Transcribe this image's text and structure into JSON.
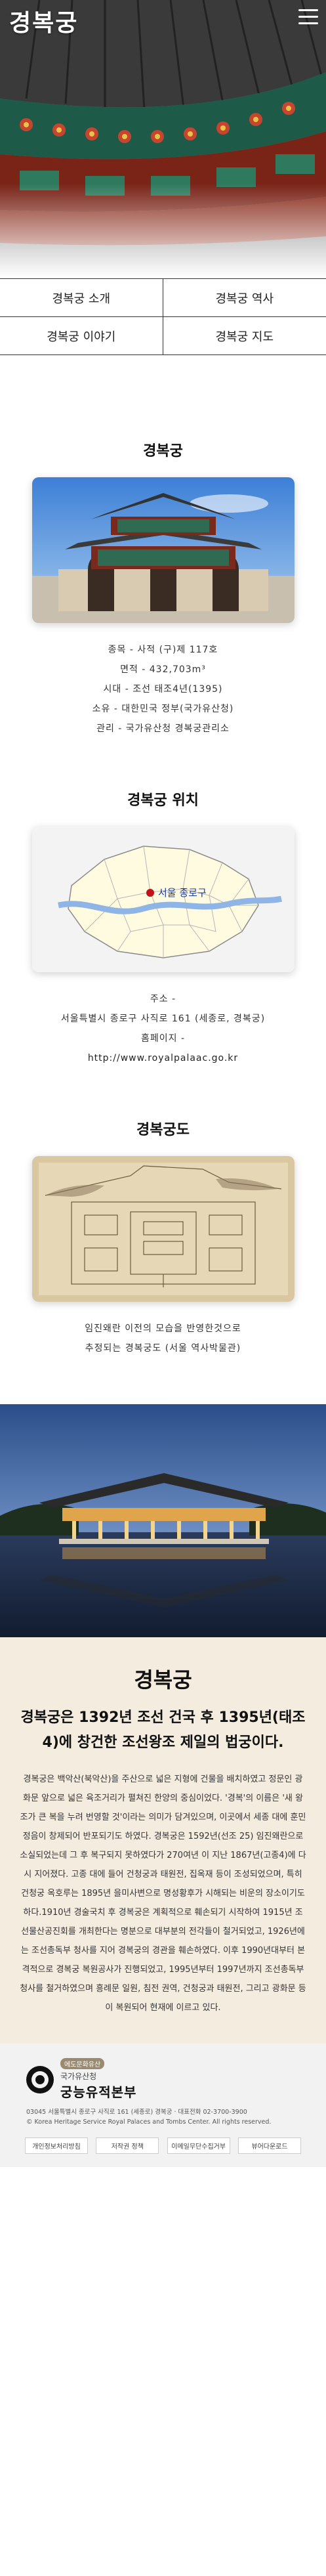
{
  "header": {
    "brand": "경복궁",
    "menu_icon": "hamburger-menu-icon"
  },
  "nav": {
    "items": [
      {
        "label": "경복궁 소개"
      },
      {
        "label": "경복궁 역사"
      },
      {
        "label": "경복궁 이야기"
      },
      {
        "label": "경복궁 지도"
      }
    ]
  },
  "intro": {
    "title": "경복궁",
    "lines": [
      "종목 - 사적 (구)제 117호",
      "면적 - 432,703m³",
      "시대 - 조선 태조4년(1395)",
      "소유 - 대한민국 정부(국가유산청)",
      "관리 - 국가유산청 경복궁관리소"
    ]
  },
  "location": {
    "title": "경복궁 위치",
    "map_label": "서울 종로구",
    "lines": [
      "주소 -",
      "서울특별시 종로구 사직로 161 (세종로, 경복궁)",
      "홈페이지 -",
      "http://www.royalpalaac.go.kr"
    ]
  },
  "palace_map": {
    "title": "경복궁도",
    "lines": [
      "임진왜란 이전의 모습을 반영한것으로",
      "추정되는 경복궁도 (서울 역사박물관)"
    ]
  },
  "about": {
    "title": "경복궁",
    "lead": "경복궁은 1392년 조선 건국 후 1395년(태조 4)에 창건한 조선왕조 제일의 법궁이다.",
    "body": "경복궁은 백악산(북악산)을 주산으로 넓은 지형에 건물을 배치하였고 정문인 광화문 앞으로 넓은 육조거리가 펼쳐진 한양의 중심이었다. '경복'의 이름은 '새 왕조가 큰 복을 누려 번영할 것'이라는 의미가 담겨있으며, 이곳에서 세종 대에 훈민정음이 창제되어 반포되기도 하였다. 경복궁은 1592년(선조 25) 임진왜란으로 소실되었는데 그 후 복구되지 못하였다가 270여년 이 지난 1867년(고종4)에 다시 지어졌다. 고종 대에 들어 건청궁과 태원전, 집옥재 등이 조성되었으며, 특히 건청궁 옥호루는 1895년 을미사변으로 명성황후가 시해되는 비운의 장소이기도 하다.1910년 경술국치 후 경복궁은 계획적으로 훼손되기 시작하여 1915년 조선물산공진회를 개최한다는 명분으로 대부분의 전각들이 철거되었고, 1926년에는 조선총독부 청사를 지어 경복궁의 경관을 훼손하였다. 이후 1990년대부터 본격적으로 경복궁 복원공사가 진행되었고, 1995년부터 1997년까지 조선총독부 청사를 철거하였으며 흥례문 일원, 침전 권역, 건청궁과 태원전, 그리고 광화문 등이 복원되어 현재에 이르고 있다."
  },
  "footer": {
    "tag": "에도문화유산",
    "org": "국가유산청",
    "name": "궁능유적본부",
    "address": "03045 서울특별시 종로구 사직로 161 (세종로) 경복궁 · 대표전화 02-3700-3900",
    "copyright": "© Korea Heritage Service Royal Palaces and Tombs Center. All rights reserved.",
    "links": [
      "개인정보처리방침",
      "저작권 정책",
      "이메일무단수집거부",
      "뷰어다운로드"
    ]
  },
  "colors": {
    "about_bg": "#f4ecdf",
    "footer_bg": "#f2f2f2",
    "map_marker": "#c0121b",
    "map_river": "#8fb4e6"
  }
}
